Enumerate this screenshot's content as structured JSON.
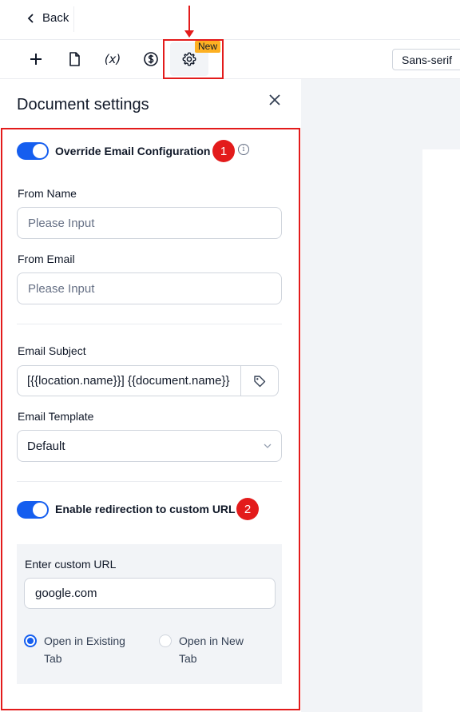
{
  "topbar": {
    "back_label": "Back"
  },
  "toolbar": {
    "tools": [
      "plus-icon",
      "document-icon",
      "variable-icon",
      "dollar-icon",
      "gear-icon"
    ],
    "variable_label": "(x)",
    "new_badge": "New",
    "font_value": "Sans-serif"
  },
  "panel": {
    "title": "Document settings",
    "override_toggle": {
      "label": "Override Email Configuration",
      "enabled": true,
      "badge": "1"
    },
    "from_name": {
      "label": "From Name",
      "placeholder": "Please Input"
    },
    "from_email": {
      "label": "From Email",
      "placeholder": "Please Input"
    },
    "email_subject": {
      "label": "Email Subject",
      "value": "[{{location.name}}] {{document.name}}"
    },
    "email_template": {
      "label": "Email Template",
      "value": "Default"
    },
    "redirect_toggle": {
      "label": "Enable redirection to custom URL",
      "enabled": true,
      "badge": "2"
    },
    "custom_url": {
      "label": "Enter custom URL",
      "value": "google.com",
      "options": [
        {
          "label": "Open in Existing Tab",
          "checked": true
        },
        {
          "label": "Open in New Tab",
          "checked": false
        }
      ]
    }
  },
  "colors": {
    "accent": "#155eef",
    "annotation": "#e31b1b",
    "badge": "#fdb022"
  }
}
